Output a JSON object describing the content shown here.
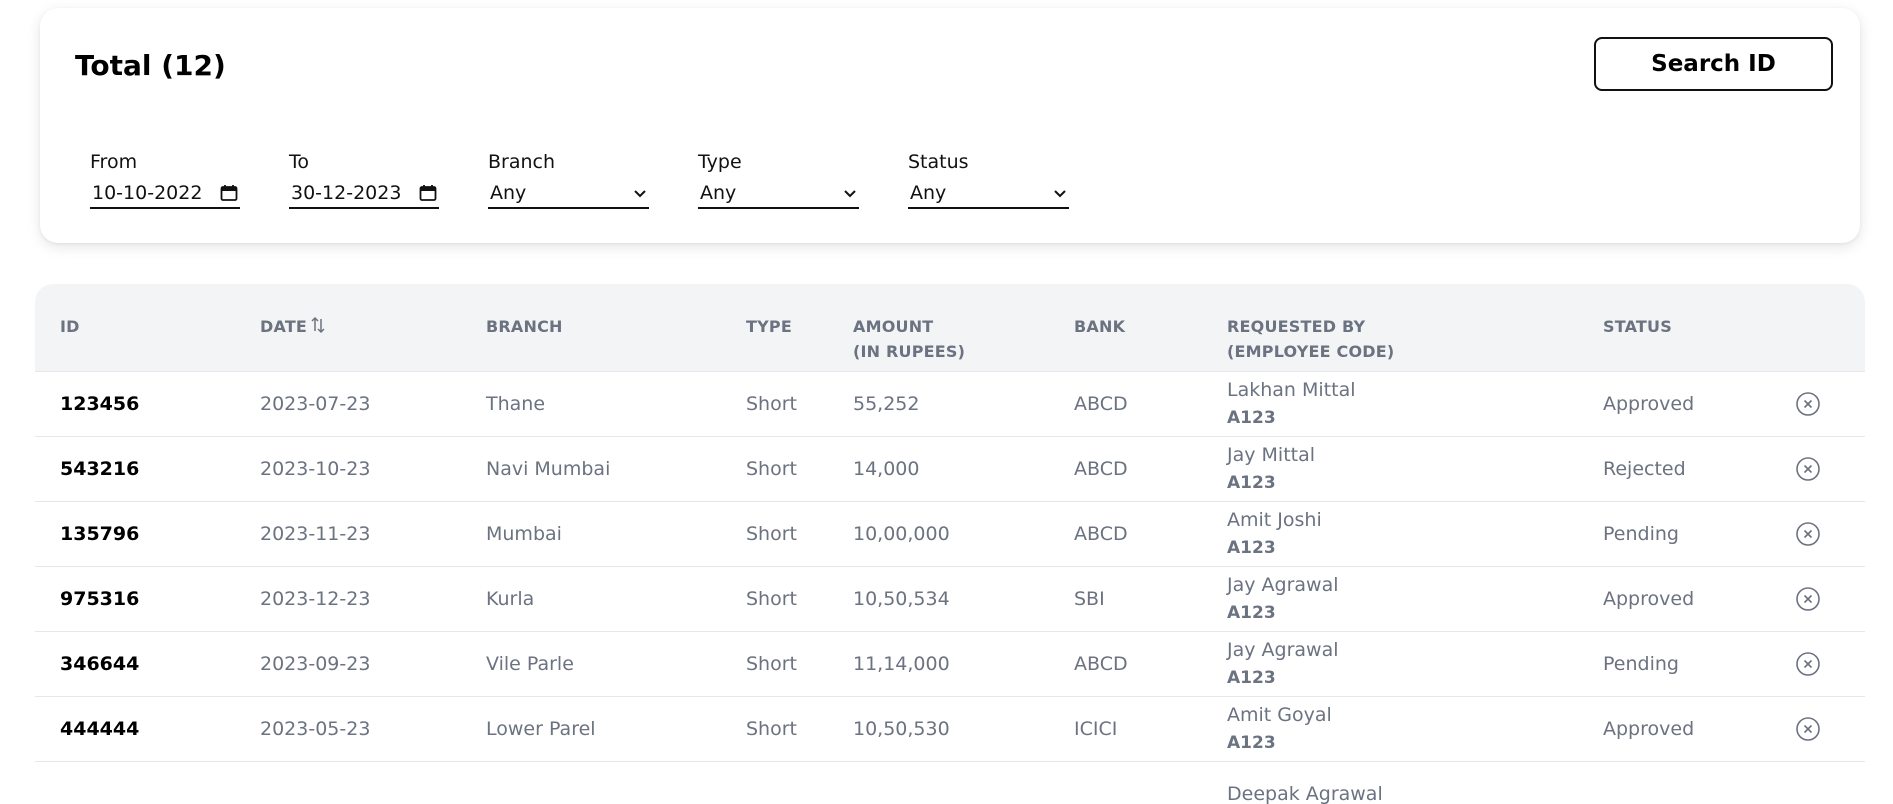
{
  "header": {
    "total_label": "Total (12)",
    "search_button": "Search ID"
  },
  "filters": {
    "from": {
      "label": "From",
      "value": "10-10-2022",
      "icon": "calendar-icon"
    },
    "to": {
      "label": "To",
      "value": "30-12-2023",
      "icon": "calendar-icon"
    },
    "branch": {
      "label": "Branch",
      "value": "Any"
    },
    "type": {
      "label": "Type",
      "value": "Any"
    },
    "status": {
      "label": "Status",
      "value": "Any"
    }
  },
  "table": {
    "columns": {
      "id": "ID",
      "date": "DATE",
      "branch": "BRANCH",
      "type": "TYPE",
      "amount_1": "AMOUNT",
      "amount_2": "(IN RUPEES)",
      "bank": "BANK",
      "requested_1": "REQUESTED BY",
      "requested_2": "(EMPLOYEE CODE)",
      "status": "STATUS"
    },
    "rows": [
      {
        "id": "123456",
        "date": "2023-07-23",
        "branch": "Thane",
        "type": "Short",
        "amount": "55,252",
        "bank": "ABCD",
        "name": "Lakhan Mittal",
        "code": "A123",
        "status": "Approved"
      },
      {
        "id": "543216",
        "date": "2023-10-23",
        "branch": "Navi Mumbai",
        "type": "Short",
        "amount": "14,000",
        "bank": "ABCD",
        "name": "Jay Mittal",
        "code": "A123",
        "status": "Rejected"
      },
      {
        "id": "135796",
        "date": "2023-11-23",
        "branch": "Mumbai",
        "type": "Short",
        "amount": "10,00,000",
        "bank": "ABCD",
        "name": "Amit Joshi",
        "code": "A123",
        "status": "Pending"
      },
      {
        "id": "975316",
        "date": "2023-12-23",
        "branch": "Kurla",
        "type": "Short",
        "amount": "10,50,534",
        "bank": "SBI",
        "name": "Jay Agrawal",
        "code": "A123",
        "status": "Approved"
      },
      {
        "id": "346644",
        "date": "2023-09-23",
        "branch": "Vile Parle",
        "type": "Short",
        "amount": "11,14,000",
        "bank": "ABCD",
        "name": "Jay Agrawal",
        "code": "A123",
        "status": "Pending"
      },
      {
        "id": "444444",
        "date": "2023-05-23",
        "branch": "Lower Parel",
        "type": "Short",
        "amount": "10,50,530",
        "bank": "ICICI",
        "name": "Amit Goyal",
        "code": "A123",
        "status": "Approved"
      },
      {
        "id": "",
        "date": "",
        "branch": "",
        "type": "",
        "amount": "",
        "bank": "",
        "name": "Deepak Agrawal",
        "code": "",
        "status": ""
      }
    ]
  }
}
